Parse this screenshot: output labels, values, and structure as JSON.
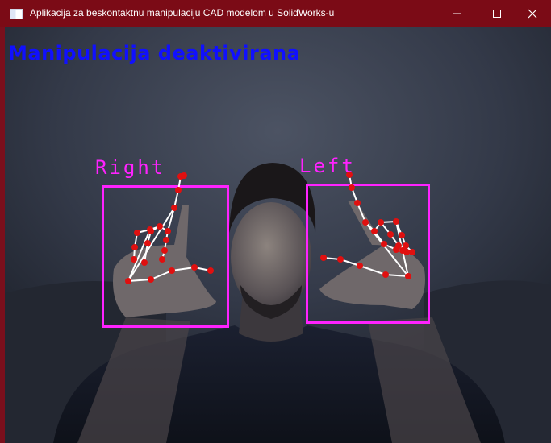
{
  "window": {
    "title": "Aplikacija za beskontaktnu manipulaciju CAD modelom u SolidWorks-u",
    "title_bar_color": "#7b0b16",
    "icons": {
      "app": "app-window-icon",
      "minimize": "minimize-icon",
      "maximize": "maximize-icon",
      "close": "close-icon"
    }
  },
  "overlay": {
    "status": "Manipulacija deaktivirana",
    "status_color": "#1010ff",
    "hand_label_color": "#ff22ff",
    "landmark_color": "#e01010",
    "connection_color": "#ffffff",
    "hands": [
      {
        "label": "Right"
      },
      {
        "label": "Left"
      }
    ]
  }
}
